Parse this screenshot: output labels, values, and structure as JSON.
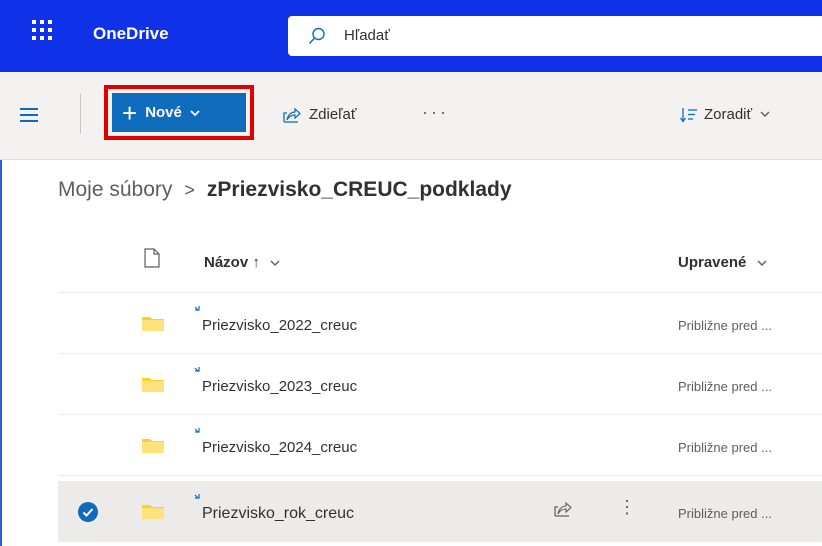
{
  "app": {
    "brand": "OneDrive"
  },
  "search": {
    "placeholder": "Hľadať"
  },
  "toolbar": {
    "new_label": "Nové",
    "share_label": "Zdieľať",
    "more_label": "···",
    "sort_label": "Zoradiť"
  },
  "breadcrumb": {
    "root": "Moje súbory",
    "separator": ">",
    "current": "zPriezvisko_CREUC_podklady"
  },
  "list": {
    "columns": {
      "name": "Názov ↑",
      "modified": "Upravené"
    },
    "rows": [
      {
        "name": "Priezvisko_2022_creuc",
        "modified": "Približne pred ...",
        "selected": false
      },
      {
        "name": "Priezvisko_2023_creuc",
        "modified": "Približne pred ...",
        "selected": false
      },
      {
        "name": "Priezvisko_2024_creuc",
        "modified": "Približne pred ...",
        "selected": false
      },
      {
        "name": "Priezvisko_rok_creuc",
        "modified": "Približne pred ...",
        "selected": true
      }
    ]
  },
  "colors": {
    "header": "#0f32e8",
    "accent": "#0f6cbd",
    "highlight": "#e00000",
    "folder": "#f8d22a"
  },
  "icons": [
    "app-launcher-icon",
    "search-icon",
    "menu-icon",
    "plus-icon",
    "chevron-down-icon",
    "share-icon",
    "more-icon",
    "sort-icon",
    "file-icon",
    "folder-icon",
    "sync-icon",
    "checkmark-icon"
  ]
}
